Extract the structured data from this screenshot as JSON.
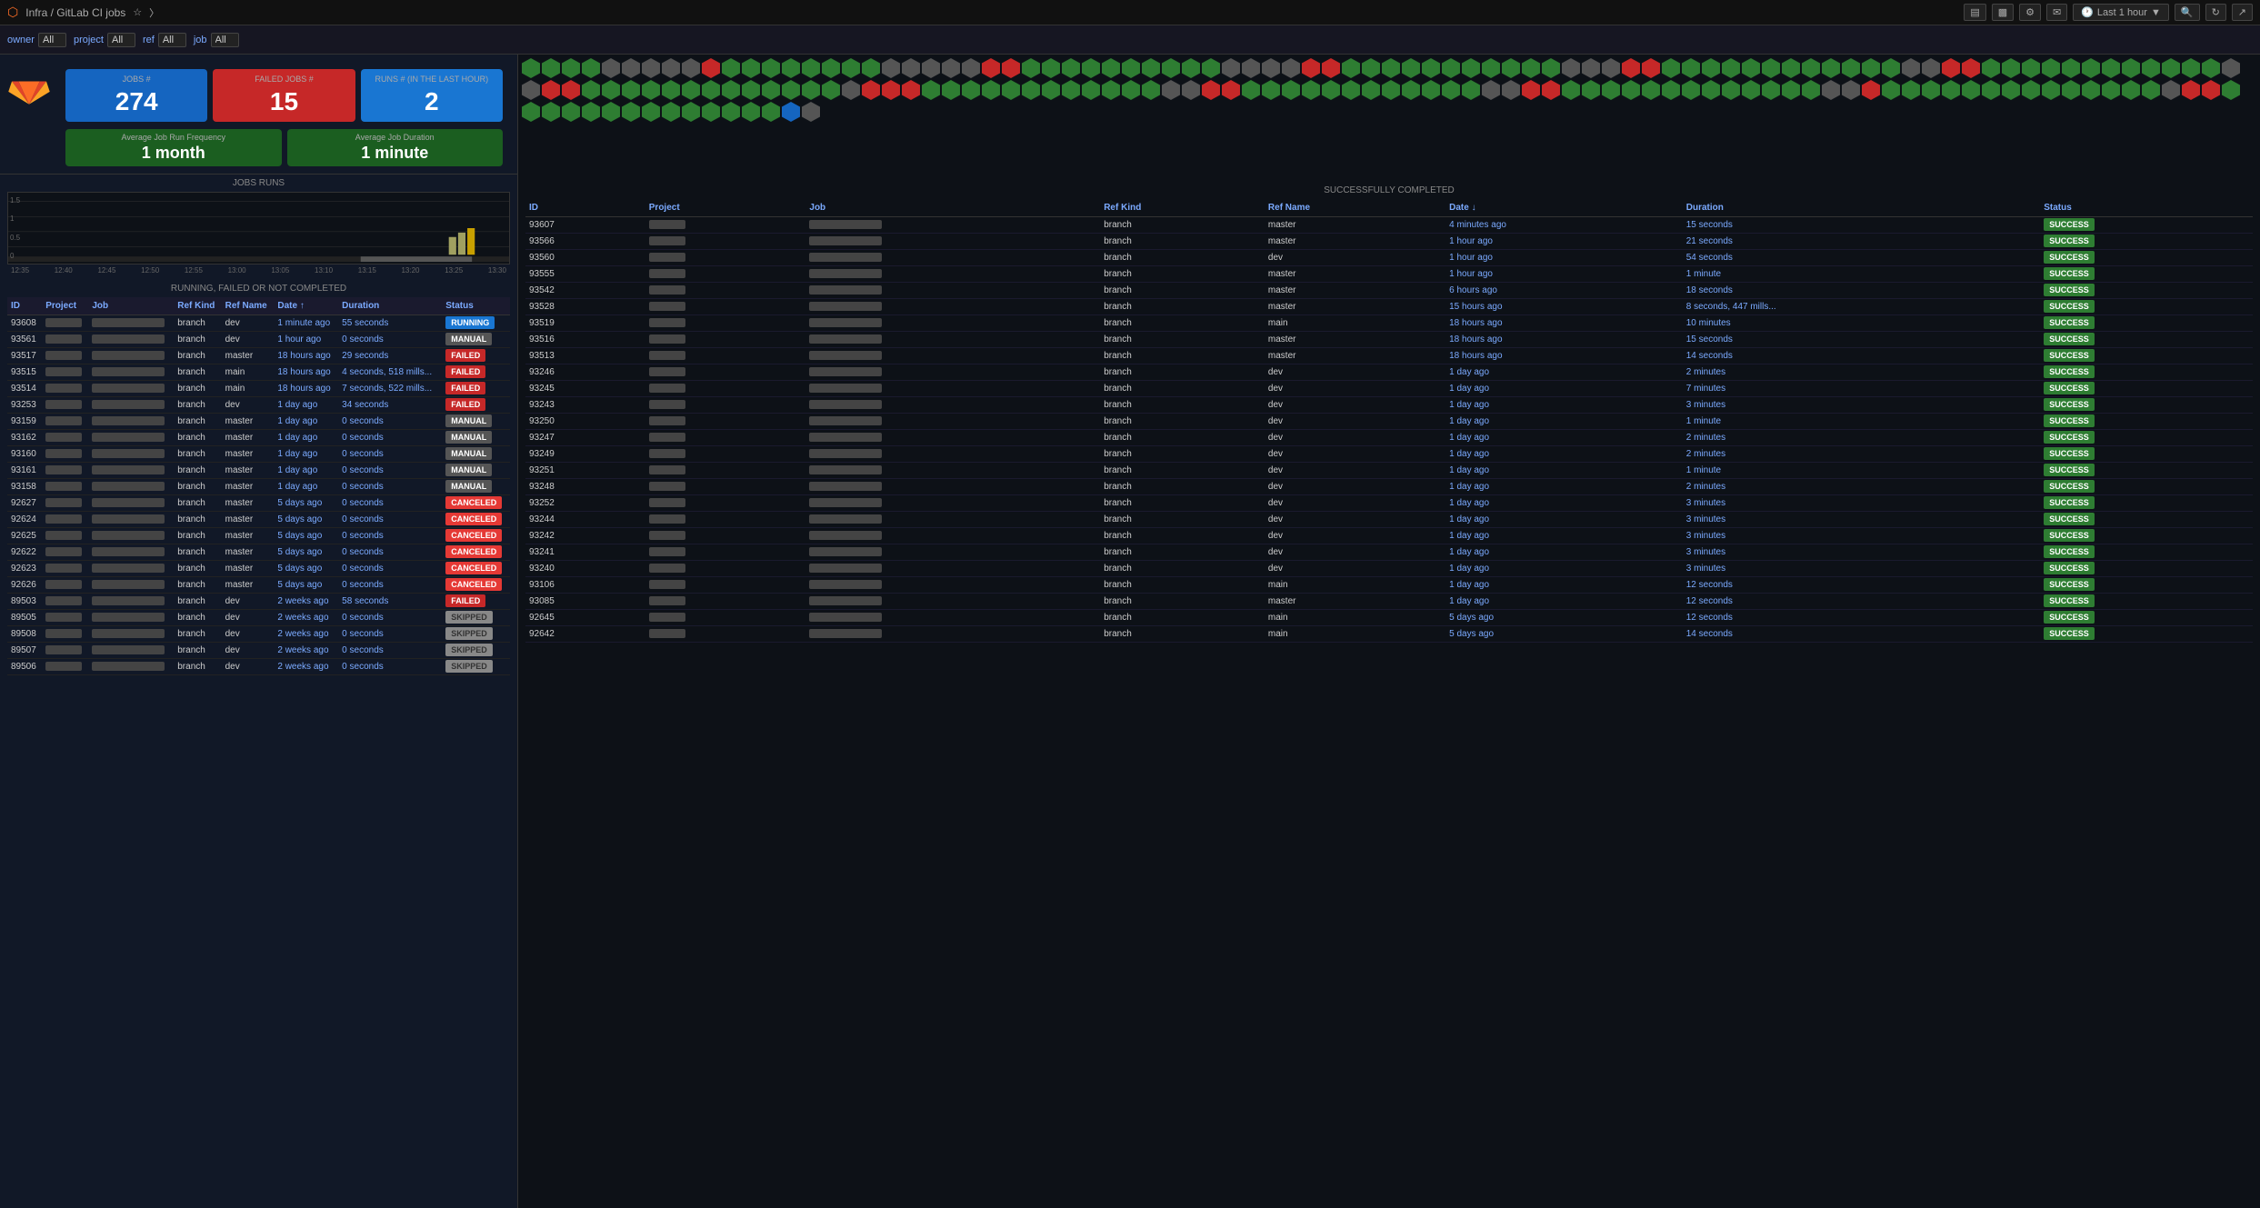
{
  "topbar": {
    "title": "Infra / GitLab CI jobs",
    "time_label": "Last 1 hour",
    "icons": [
      "chart-icon",
      "bar-icon",
      "gear-icon",
      "comment-icon",
      "refresh-icon",
      "expand-icon"
    ]
  },
  "filters": [
    {
      "label": "owner",
      "value": "All"
    },
    {
      "label": "project",
      "value": "All"
    },
    {
      "label": "ref",
      "value": "All"
    },
    {
      "label": "job",
      "value": "All"
    }
  ],
  "stats": {
    "jobs": {
      "label": "JOBS #",
      "value": "274"
    },
    "failed": {
      "label": "FAILED JOBS #",
      "value": "15"
    },
    "runs": {
      "label": "RUNS # (in the last hour)",
      "value": "2"
    }
  },
  "averages": {
    "frequency": {
      "label": "Average Job Run Frequency",
      "value": "1 month"
    },
    "duration": {
      "label": "Average Job Duration",
      "value": "1 minute"
    }
  },
  "chart": {
    "title": "JOBS RUNS",
    "y_labels": [
      "1.5",
      "1",
      "0.5",
      "0"
    ],
    "x_labels": [
      "12:35",
      "12:40",
      "12:45",
      "12:50",
      "12:55",
      "13:00",
      "13:05",
      "13:10",
      "13:15",
      "13:20",
      "13:25",
      "13:30"
    ]
  },
  "left_table": {
    "title": "RUNNING, FAILED OR NOT COMPLETED",
    "headers": [
      "ID",
      "Project",
      "Job",
      "Ref Kind",
      "Ref Name",
      "Date ↑",
      "Duration",
      "Status"
    ],
    "rows": [
      {
        "id": "93608",
        "project": "",
        "job": "",
        "ref_kind": "branch",
        "ref_name": "dev",
        "date": "1 minute ago",
        "duration": "55 seconds",
        "status": "RUNNING",
        "status_class": "status-running"
      },
      {
        "id": "93561",
        "project": "",
        "job": "",
        "ref_kind": "branch",
        "ref_name": "dev",
        "date": "1 hour ago",
        "duration": "0 seconds",
        "status": "MANUAL",
        "status_class": "status-manual"
      },
      {
        "id": "93517",
        "project": "",
        "job": "",
        "ref_kind": "branch",
        "ref_name": "master",
        "date": "18 hours ago",
        "duration": "29 seconds",
        "status": "FAILED",
        "status_class": "status-failed"
      },
      {
        "id": "93515",
        "project": "",
        "job": "",
        "ref_kind": "branch",
        "ref_name": "main",
        "date": "18 hours ago",
        "duration": "4 seconds, 518 mills...",
        "status": "FAILED",
        "status_class": "status-failed"
      },
      {
        "id": "93514",
        "project": "",
        "job": "",
        "ref_kind": "branch",
        "ref_name": "main",
        "date": "18 hours ago",
        "duration": "7 seconds, 522 mills...",
        "status": "FAILED",
        "status_class": "status-failed"
      },
      {
        "id": "93253",
        "project": "",
        "job": "",
        "ref_kind": "branch",
        "ref_name": "dev",
        "date": "1 day ago",
        "duration": "34 seconds",
        "status": "FAILED",
        "status_class": "status-failed"
      },
      {
        "id": "93159",
        "project": "",
        "job": "",
        "ref_kind": "branch",
        "ref_name": "master",
        "date": "1 day ago",
        "duration": "0 seconds",
        "status": "MANUAL",
        "status_class": "status-manual"
      },
      {
        "id": "93162",
        "project": "",
        "job": "",
        "ref_kind": "branch",
        "ref_name": "master",
        "date": "1 day ago",
        "duration": "0 seconds",
        "status": "MANUAL",
        "status_class": "status-manual"
      },
      {
        "id": "93160",
        "project": "",
        "job": "",
        "ref_kind": "branch",
        "ref_name": "master",
        "date": "1 day ago",
        "duration": "0 seconds",
        "status": "MANUAL",
        "status_class": "status-manual"
      },
      {
        "id": "93161",
        "project": "",
        "job": "",
        "ref_kind": "branch",
        "ref_name": "master",
        "date": "1 day ago",
        "duration": "0 seconds",
        "status": "MANUAL",
        "status_class": "status-manual"
      },
      {
        "id": "93158",
        "project": "",
        "job": "",
        "ref_kind": "branch",
        "ref_name": "master",
        "date": "1 day ago",
        "duration": "0 seconds",
        "status": "MANUAL",
        "status_class": "status-manual"
      },
      {
        "id": "92627",
        "project": "",
        "job": "",
        "ref_kind": "branch",
        "ref_name": "master",
        "date": "5 days ago",
        "duration": "0 seconds",
        "status": "CANCELED",
        "status_class": "status-cancelled"
      },
      {
        "id": "92624",
        "project": "",
        "job": "",
        "ref_kind": "branch",
        "ref_name": "master",
        "date": "5 days ago",
        "duration": "0 seconds",
        "status": "CANCELED",
        "status_class": "status-cancelled"
      },
      {
        "id": "92625",
        "project": "",
        "job": "",
        "ref_kind": "branch",
        "ref_name": "master",
        "date": "5 days ago",
        "duration": "0 seconds",
        "status": "CANCELED",
        "status_class": "status-cancelled"
      },
      {
        "id": "92622",
        "project": "",
        "job": "",
        "ref_kind": "branch",
        "ref_name": "master",
        "date": "5 days ago",
        "duration": "0 seconds",
        "status": "CANCELED",
        "status_class": "status-cancelled"
      },
      {
        "id": "92623",
        "project": "",
        "job": "",
        "ref_kind": "branch",
        "ref_name": "master",
        "date": "5 days ago",
        "duration": "0 seconds",
        "status": "CANCELED",
        "status_class": "status-cancelled"
      },
      {
        "id": "92626",
        "project": "",
        "job": "",
        "ref_kind": "branch",
        "ref_name": "master",
        "date": "5 days ago",
        "duration": "0 seconds",
        "status": "CANCELED",
        "status_class": "status-cancelled"
      },
      {
        "id": "89503",
        "project": "",
        "job": "",
        "ref_kind": "branch",
        "ref_name": "dev",
        "date": "2 weeks ago",
        "duration": "58 seconds",
        "status": "FAILED",
        "status_class": "status-failed"
      },
      {
        "id": "89505",
        "project": "",
        "job": "",
        "ref_kind": "branch",
        "ref_name": "dev",
        "date": "2 weeks ago",
        "duration": "0 seconds",
        "status": "SKIPPED",
        "status_class": "status-skipped"
      },
      {
        "id": "89508",
        "project": "",
        "job": "",
        "ref_kind": "branch",
        "ref_name": "dev",
        "date": "2 weeks ago",
        "duration": "0 seconds",
        "status": "SKIPPED",
        "status_class": "status-skipped"
      },
      {
        "id": "89507",
        "project": "",
        "job": "",
        "ref_kind": "branch",
        "ref_name": "dev",
        "date": "2 weeks ago",
        "duration": "0 seconds",
        "status": "SKIPPED",
        "status_class": "status-skipped"
      },
      {
        "id": "89506",
        "project": "",
        "job": "",
        "ref_kind": "branch",
        "ref_name": "dev",
        "date": "2 weeks ago",
        "duration": "0 seconds",
        "status": "SKIPPED",
        "status_class": "status-skipped"
      }
    ]
  },
  "right_table": {
    "title": "SUCCESSFULLY COMPLETED",
    "headers": [
      "ID",
      "Project",
      "Job",
      "Ref Kind",
      "Ref Name",
      "Date ↓",
      "Duration",
      "Status"
    ],
    "rows": [
      {
        "id": "93607",
        "project": "",
        "job": "",
        "ref_kind": "branch",
        "ref_name": "master",
        "date": "4 minutes ago",
        "duration": "15 seconds",
        "status": "SUCCESS"
      },
      {
        "id": "93566",
        "project": "",
        "job": "",
        "ref_kind": "branch",
        "ref_name": "master",
        "date": "1 hour ago",
        "duration": "21 seconds",
        "status": "SUCCESS"
      },
      {
        "id": "93560",
        "project": "",
        "job": "",
        "ref_kind": "branch",
        "ref_name": "dev",
        "date": "1 hour ago",
        "duration": "54 seconds",
        "status": "SUCCESS"
      },
      {
        "id": "93555",
        "project": "",
        "job": "",
        "ref_kind": "branch",
        "ref_name": "master",
        "date": "1 hour ago",
        "duration": "1 minute",
        "status": "SUCCESS"
      },
      {
        "id": "93542",
        "project": "",
        "job": "",
        "ref_kind": "branch",
        "ref_name": "master",
        "date": "6 hours ago",
        "duration": "18 seconds",
        "status": "SUCCESS"
      },
      {
        "id": "93528",
        "project": "",
        "job": "",
        "ref_kind": "branch",
        "ref_name": "master",
        "date": "15 hours ago",
        "duration": "8 seconds, 447 mills...",
        "status": "SUCCESS"
      },
      {
        "id": "93519",
        "project": "",
        "job": "",
        "ref_kind": "branch",
        "ref_name": "main",
        "date": "18 hours ago",
        "duration": "10 minutes",
        "status": "SUCCESS"
      },
      {
        "id": "93516",
        "project": "",
        "job": "",
        "ref_kind": "branch",
        "ref_name": "master",
        "date": "18 hours ago",
        "duration": "15 seconds",
        "status": "SUCCESS"
      },
      {
        "id": "93513",
        "project": "",
        "job": "",
        "ref_kind": "branch",
        "ref_name": "master",
        "date": "18 hours ago",
        "duration": "14 seconds",
        "status": "SUCCESS"
      },
      {
        "id": "93246",
        "project": "",
        "job": "",
        "ref_kind": "branch",
        "ref_name": "dev",
        "date": "1 day ago",
        "duration": "2 minutes",
        "status": "SUCCESS"
      },
      {
        "id": "93245",
        "project": "",
        "job": "",
        "ref_kind": "branch",
        "ref_name": "dev",
        "date": "1 day ago",
        "duration": "7 minutes",
        "status": "SUCCESS"
      },
      {
        "id": "93243",
        "project": "",
        "job": "",
        "ref_kind": "branch",
        "ref_name": "dev",
        "date": "1 day ago",
        "duration": "3 minutes",
        "status": "SUCCESS"
      },
      {
        "id": "93250",
        "project": "",
        "job": "",
        "ref_kind": "branch",
        "ref_name": "dev",
        "date": "1 day ago",
        "duration": "1 minute",
        "status": "SUCCESS"
      },
      {
        "id": "93247",
        "project": "",
        "job": "",
        "ref_kind": "branch",
        "ref_name": "dev",
        "date": "1 day ago",
        "duration": "2 minutes",
        "status": "SUCCESS"
      },
      {
        "id": "93249",
        "project": "",
        "job": "",
        "ref_kind": "branch",
        "ref_name": "dev",
        "date": "1 day ago",
        "duration": "2 minutes",
        "status": "SUCCESS"
      },
      {
        "id": "93251",
        "project": "",
        "job": "",
        "ref_kind": "branch",
        "ref_name": "dev",
        "date": "1 day ago",
        "duration": "1 minute",
        "status": "SUCCESS"
      },
      {
        "id": "93248",
        "project": "",
        "job": "",
        "ref_kind": "branch",
        "ref_name": "dev",
        "date": "1 day ago",
        "duration": "2 minutes",
        "status": "SUCCESS"
      },
      {
        "id": "93252",
        "project": "",
        "job": "",
        "ref_kind": "branch",
        "ref_name": "dev",
        "date": "1 day ago",
        "duration": "3 minutes",
        "status": "SUCCESS"
      },
      {
        "id": "93244",
        "project": "",
        "job": "",
        "ref_kind": "branch",
        "ref_name": "dev",
        "date": "1 day ago",
        "duration": "3 minutes",
        "status": "SUCCESS"
      },
      {
        "id": "93242",
        "project": "",
        "job": "",
        "ref_kind": "branch",
        "ref_name": "dev",
        "date": "1 day ago",
        "duration": "3 minutes",
        "status": "SUCCESS"
      },
      {
        "id": "93241",
        "project": "",
        "job": "",
        "ref_kind": "branch",
        "ref_name": "dev",
        "date": "1 day ago",
        "duration": "3 minutes",
        "status": "SUCCESS"
      },
      {
        "id": "93240",
        "project": "",
        "job": "",
        "ref_kind": "branch",
        "ref_name": "dev",
        "date": "1 day ago",
        "duration": "3 minutes",
        "status": "SUCCESS"
      },
      {
        "id": "93106",
        "project": "",
        "job": "",
        "ref_kind": "branch",
        "ref_name": "main",
        "date": "1 day ago",
        "duration": "12 seconds",
        "status": "SUCCESS"
      },
      {
        "id": "93085",
        "project": "",
        "job": "",
        "ref_kind": "branch",
        "ref_name": "master",
        "date": "1 day ago",
        "duration": "12 seconds",
        "status": "SUCCESS"
      },
      {
        "id": "92645",
        "project": "",
        "job": "",
        "ref_kind": "branch",
        "ref_name": "main",
        "date": "5 days ago",
        "duration": "12 seconds",
        "status": "SUCCESS"
      },
      {
        "id": "92642",
        "project": "",
        "job": "",
        "ref_kind": "branch",
        "ref_name": "main",
        "date": "5 days ago",
        "duration": "14 seconds",
        "status": "SUCCESS"
      }
    ]
  },
  "hex_colors": [
    "green",
    "green",
    "green",
    "green",
    "gray",
    "gray",
    "gray",
    "gray",
    "gray",
    "red",
    "green",
    "green",
    "green",
    "green",
    "green",
    "green",
    "green",
    "green",
    "gray",
    "gray",
    "gray",
    "gray",
    "gray",
    "red",
    "red",
    "green",
    "green",
    "green",
    "green",
    "green",
    "green",
    "green",
    "green",
    "green",
    "green",
    "gray",
    "gray",
    "gray",
    "gray",
    "red",
    "red",
    "green",
    "green",
    "green",
    "green",
    "green",
    "green",
    "green",
    "green",
    "green",
    "green",
    "green",
    "gray",
    "gray",
    "gray",
    "red",
    "red",
    "green",
    "green",
    "green",
    "green",
    "green",
    "green",
    "green",
    "green",
    "green",
    "green",
    "green",
    "green",
    "gray",
    "gray",
    "red",
    "red",
    "green",
    "green",
    "green",
    "green",
    "green",
    "green",
    "green",
    "green",
    "green",
    "green",
    "green",
    "green",
    "gray",
    "gray",
    "red",
    "red",
    "green",
    "green",
    "green",
    "green",
    "green",
    "green",
    "green",
    "green",
    "green",
    "green",
    "green",
    "green",
    "green",
    "gray",
    "red",
    "red",
    "red",
    "green",
    "green",
    "green",
    "green",
    "green",
    "green",
    "green",
    "green",
    "green",
    "green",
    "green",
    "green",
    "gray",
    "gray",
    "red",
    "red",
    "green",
    "green",
    "green",
    "green",
    "green",
    "green",
    "green",
    "green",
    "green",
    "green",
    "green",
    "green",
    "gray",
    "gray",
    "red",
    "red",
    "green",
    "green",
    "green",
    "green",
    "green",
    "green",
    "green",
    "green",
    "green",
    "green",
    "green",
    "green",
    "green",
    "gray",
    "gray",
    "red",
    "green",
    "green",
    "green",
    "green",
    "green",
    "green",
    "green",
    "green",
    "green",
    "green",
    "green",
    "green",
    "green",
    "green",
    "gray",
    "red",
    "red",
    "green",
    "green",
    "green",
    "green",
    "green",
    "green",
    "green",
    "green",
    "green",
    "green",
    "green",
    "green",
    "green",
    "green",
    "blue",
    "gray"
  ]
}
